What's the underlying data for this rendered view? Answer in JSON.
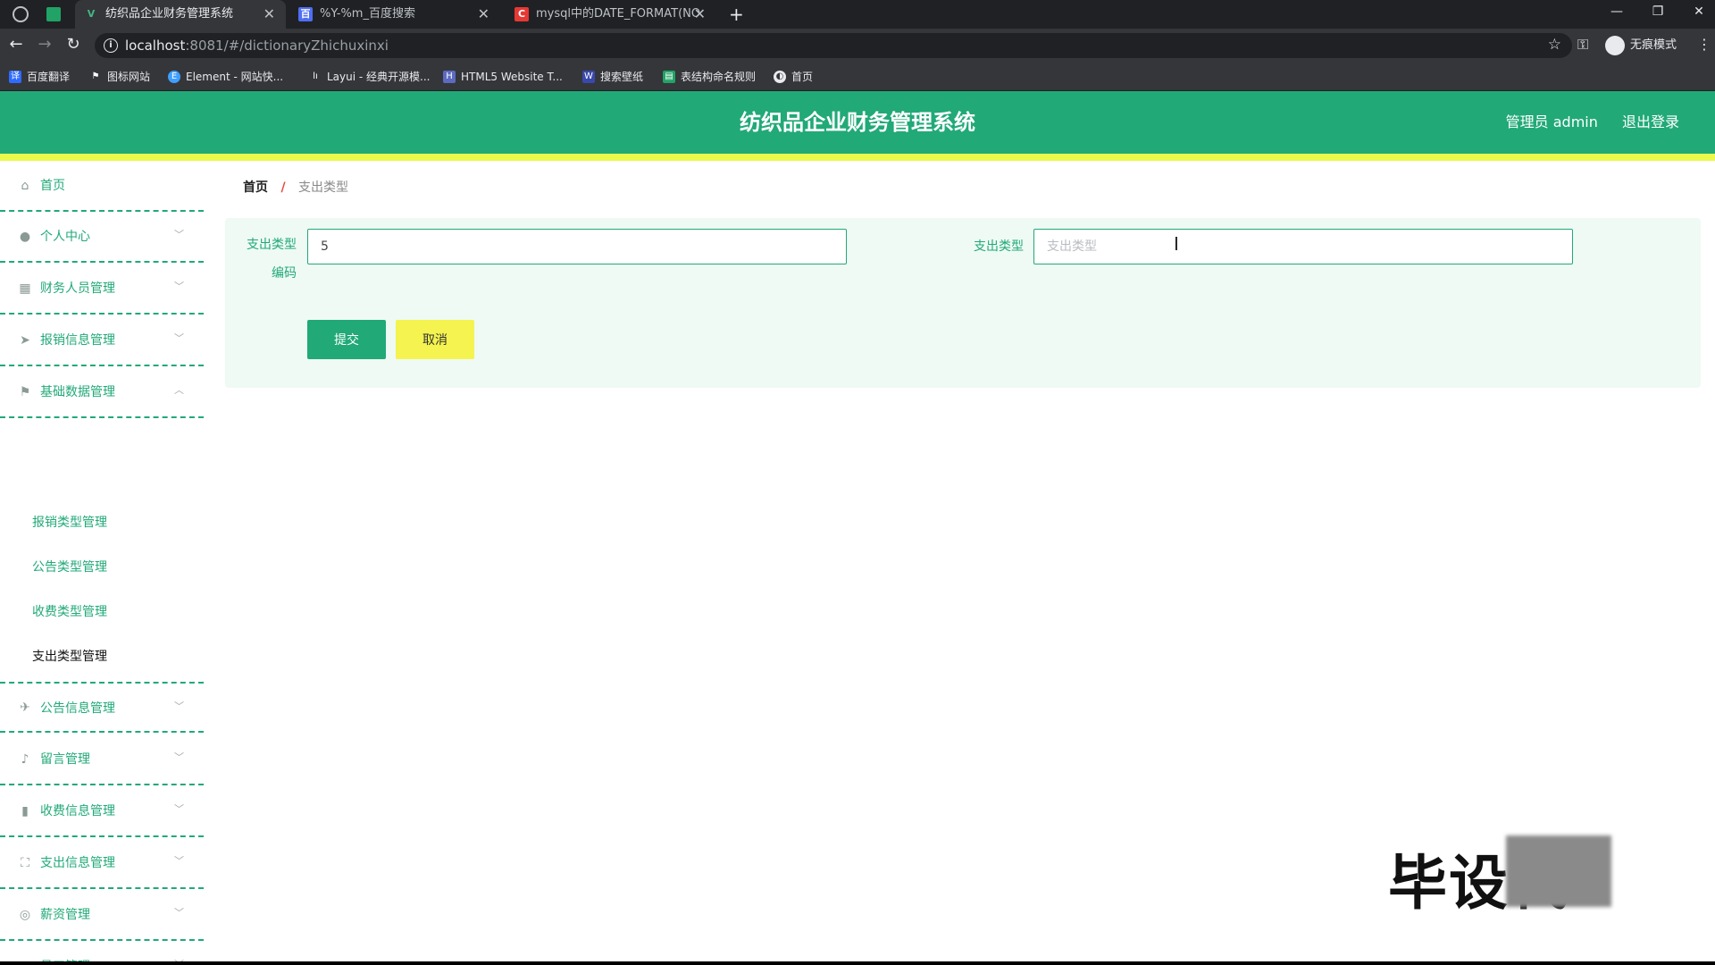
{
  "browser": {
    "tabs": [
      {
        "label": "纺织品企业财务管理系统",
        "active": true
      },
      {
        "label": "%Y-%m_百度搜索",
        "active": false
      },
      {
        "label": "mysql中的DATE_FORMAT(NO",
        "active": false
      }
    ],
    "url_host": "localhost",
    "url_rest": ":8081/#/dictionaryZhichuxinxi",
    "incognito_label": "无痕模式",
    "bookmarks": [
      "百度翻译",
      "图标网站",
      "Element - 网站快...",
      "Layui - 经典开源模...",
      "HTML5 Website T...",
      "搜索壁纸",
      "表结构命名规则",
      "首页"
    ]
  },
  "header": {
    "title": "纺织品企业财务管理系统",
    "user": "管理员 admin",
    "logout": "退出登录"
  },
  "sidebar": {
    "items": [
      {
        "label": "首页",
        "icon": "home-icon"
      },
      {
        "label": "个人中心",
        "icon": "user-icon"
      },
      {
        "label": "财务人员管理",
        "icon": "grid-icon"
      },
      {
        "label": "报销信息管理",
        "icon": "send-icon"
      },
      {
        "label": "基础数据管理",
        "icon": "flag-icon"
      },
      {
        "label": "公告信息管理",
        "icon": "paper-plane-icon"
      },
      {
        "label": "留言管理",
        "icon": "microphone-icon"
      },
      {
        "label": "收费信息管理",
        "icon": "chart-icon"
      },
      {
        "label": "支出信息管理",
        "icon": "fullscreen-icon"
      },
      {
        "label": "薪资管理",
        "icon": "coin-icon"
      },
      {
        "label": "员工管理",
        "icon": "monitor-icon"
      }
    ],
    "submenu": [
      "报销类型管理",
      "公告类型管理",
      "收费类型管理",
      "支出类型管理"
    ]
  },
  "breadcrumb": {
    "home": "首页",
    "separator": "/",
    "current": "支出类型"
  },
  "form": {
    "code_label_line1": "支出类型",
    "code_label_line2": "编码",
    "code_value": "5",
    "name_label": "支出类型",
    "name_placeholder": "支出类型",
    "submit": "提交",
    "cancel": "取消"
  },
  "watermark": "毕设代",
  "colors": {
    "primary": "#21a978",
    "accent_yellow": "#eaf94a",
    "form_bg": "#effaf4"
  }
}
